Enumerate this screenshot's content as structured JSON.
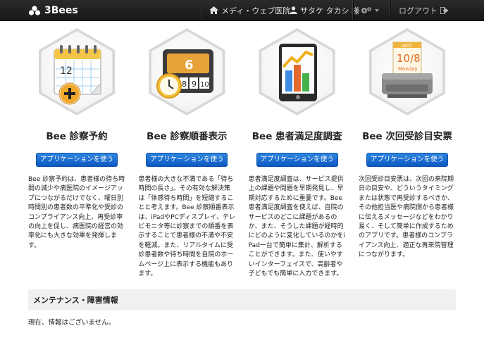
{
  "navbar": {
    "brand": "3Bees",
    "clinic": "メディ・ウェブ医院",
    "user": "サタケ タカシ 様",
    "logout": "ログアウト"
  },
  "apps": [
    {
      "title": "Bee 診察予約",
      "button": "アプリケーションを使う",
      "calendar_day": "12",
      "description": "Bee 診察予約は、患者様の待ち時間の減少や病医院のイメージアップにつながるだけでなく、曜日別時間別の患者数の平準化や受診のコンプライアンス向上、再受診率の向上を促し、病医院の経営の効率化にも大きな効果を発揮します。"
    },
    {
      "title": "Bee 診察順番表示",
      "button": "アプリケーションを使う",
      "display_main": "6",
      "display_queue": [
        "8",
        "9",
        "10"
      ],
      "description": "患者様の大きな不満である「待ち時間の長さ」。その有効な解決策は「体感待ち時間」を短縮することと考えます。Bee 診察順番表示は、iPadやPCディスプレイ、テレビモニタ等に診察までの順番を表示することで患者様の不満や不安を軽減。また、リアルタイムに受診患者数や待ち時間を自院のホームページ上に表示する機能もあります。"
    },
    {
      "title": "Bee 患者満足度調査",
      "button": "アプリケーションを使う",
      "description": "患者満足度調査は、サービス提供上の課題や問題を早期発見し、早期対応するために重要です。Bee 患者満足度調査を使えば、自院のサービスのどこに課題があるのか、また、そうした課題が経時的にどのように変化しているのかをiPad一台で簡単に集計、解析することができます。また、使いやすいインターフェイスで、高齢者や子どもでも簡単に入力できます。"
    },
    {
      "title": "Bee 次回受診目安票",
      "button": "アプリケーションを使う",
      "ticket_header": "NEXT",
      "ticket_date": "10/8",
      "ticket_weekday": "Monday",
      "description": "次回受診目安票は、次回の来院期日の目安や、どういうタイミングまたは状態で再受診するべきか、その他担当医や病院側から患者様に伝えるメッセージなどをわかり易く、そして簡単に作成するためのアプリです。患者様のコンプライアンス向上、適正な再来院管理につながります。"
    }
  ],
  "maintenance": {
    "title": "メンテナンス・障害情報",
    "body": "現在、情報はございません。"
  }
}
